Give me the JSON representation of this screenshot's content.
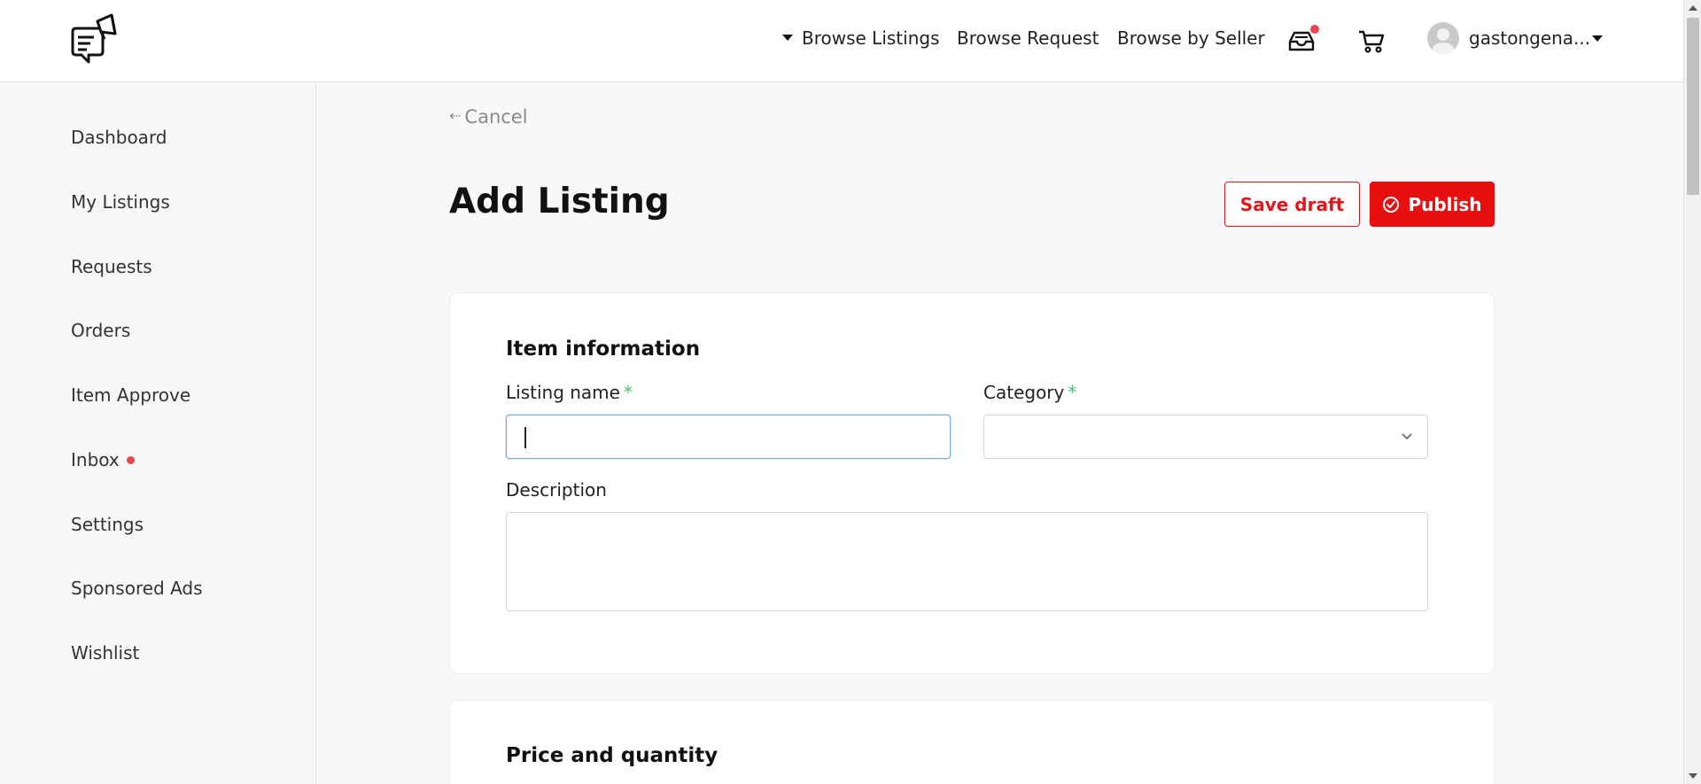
{
  "header": {
    "nav": {
      "browse_listings": "Browse Listings",
      "browse_request": "Browse Request",
      "browse_by_seller": "Browse by Seller"
    },
    "user": {
      "name": "gastongena..."
    },
    "icons": {
      "logo": "megaphone-chat-logo",
      "inbox": "inbox-tray-icon",
      "cart": "shopping-cart-icon",
      "avatar": "user-avatar"
    },
    "colors": {
      "notification": "#e5484d"
    }
  },
  "sidebar": {
    "items": [
      {
        "label": "Dashboard"
      },
      {
        "label": "My Listings"
      },
      {
        "label": "Requests"
      },
      {
        "label": "Orders"
      },
      {
        "label": "Item Approve"
      },
      {
        "label": "Inbox"
      },
      {
        "label": "Settings"
      },
      {
        "label": "Sponsored Ads"
      },
      {
        "label": "Wishlist"
      }
    ]
  },
  "main": {
    "cancel_label": "Cancel",
    "title": "Add Listing",
    "save_draft_label": "Save draft",
    "publish_label": "Publish",
    "accent_color": "#e80f10",
    "item_info": {
      "title": "Item information",
      "listing_name_label": "Listing name",
      "listing_name_value": "",
      "category_label": "Category",
      "category_value": "",
      "description_label": "Description",
      "description_value": "",
      "required_marker": "*"
    },
    "price_qty": {
      "title": "Price and quantity"
    }
  }
}
